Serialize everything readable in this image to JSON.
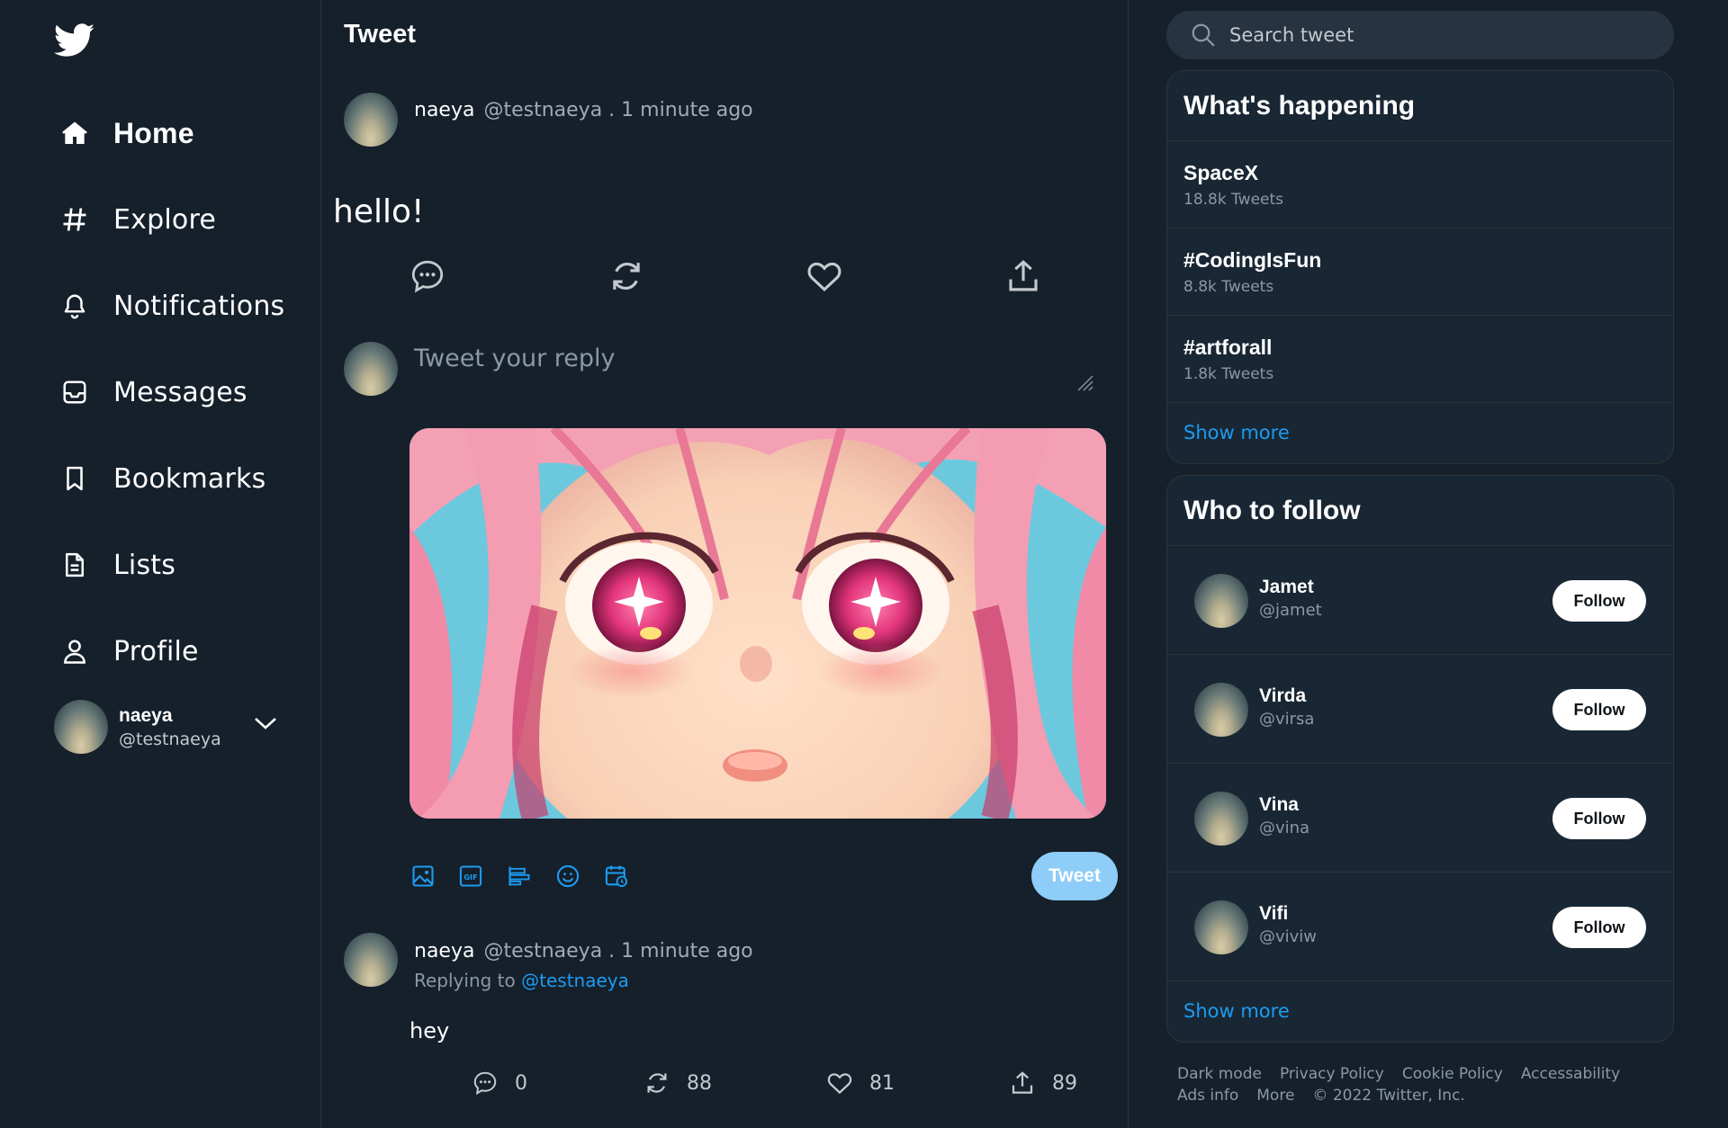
{
  "app": {
    "name": "Twitter",
    "logo_icon": "twitter-bird-icon",
    "accent": "#1d9bf0",
    "background": "#15202b"
  },
  "nav": {
    "items": [
      {
        "label": "Home",
        "icon": "home-icon"
      },
      {
        "label": "Explore",
        "icon": "hashtag-icon"
      },
      {
        "label": "Notifications",
        "icon": "bell-icon"
      },
      {
        "label": "Messages",
        "icon": "inbox-icon"
      },
      {
        "label": "Bookmarks",
        "icon": "bookmark-icon"
      },
      {
        "label": "Lists",
        "icon": "document-icon"
      },
      {
        "label": "Profile",
        "icon": "user-icon"
      }
    ],
    "account": {
      "name": "naeya",
      "handle": "@testnaeya"
    }
  },
  "main": {
    "title": "Tweet",
    "tweet": {
      "name": "naeya",
      "meta": "@testnaeya . 1 minute ago",
      "text": "hello!"
    },
    "compose": {
      "placeholder": "Tweet your reply",
      "button": "Tweet"
    },
    "reply": {
      "name": "naeya",
      "meta": "@testnaeya . 1 minute ago",
      "replying_prefix": "Replying to",
      "replying_to": "@testnaeya",
      "text": "hey",
      "stats": {
        "comments": "0",
        "retweets": "88",
        "likes": "81",
        "shares": "89"
      }
    }
  },
  "search": {
    "placeholder": "Search tweet"
  },
  "trends": {
    "title": "What's happening",
    "items": [
      {
        "topic": "SpaceX",
        "count": "18.8k Tweets"
      },
      {
        "topic": "#CodingIsFun",
        "count": "8.8k Tweets"
      },
      {
        "topic": "#artforall",
        "count": "1.8k Tweets"
      }
    ],
    "show_more": "Show more"
  },
  "who_to_follow": {
    "title": "Who to follow",
    "users": [
      {
        "name": "Jamet",
        "handle": "@jamet",
        "button": "Follow"
      },
      {
        "name": "Virda",
        "handle": "@virsa",
        "button": "Follow"
      },
      {
        "name": "Vina",
        "handle": "@vina",
        "button": "Follow"
      },
      {
        "name": "Vifi",
        "handle": "@viviw",
        "button": "Follow"
      }
    ],
    "show_more": "Show more"
  },
  "footer": {
    "links": [
      "Dark mode",
      "Privacy Policy",
      "Cookie Policy",
      "Accessability",
      "Ads info",
      "More"
    ],
    "copyright": "© 2022 Twitter, Inc."
  }
}
